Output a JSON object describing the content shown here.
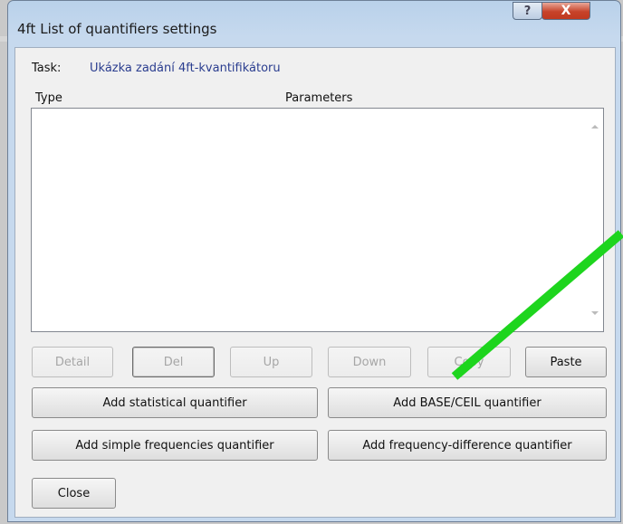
{
  "window": {
    "title": "4ft List of quantifiers settings",
    "help_glyph": "?",
    "close_glyph": "X"
  },
  "task": {
    "label": "Task:",
    "value": "Ukázka zadání 4ft-kvantifikátoru"
  },
  "list": {
    "columns": [
      "Type",
      "Parameters"
    ],
    "rows": []
  },
  "buttons": {
    "detail": "Detail",
    "del": "Del",
    "up": "Up",
    "down": "Down",
    "copy": "Copy",
    "paste": "Paste",
    "add_statistical": "Add statistical quantifier",
    "add_base_ceil": "Add BASE/CEIL quantifier",
    "add_simple_freq": "Add simple frequencies quantifier",
    "add_freq_diff": "Add frequency-difference quantifier",
    "close": "Close"
  },
  "colors": {
    "annotation_line": "#1ed51e",
    "task_value_text": "#2a3d8f"
  }
}
